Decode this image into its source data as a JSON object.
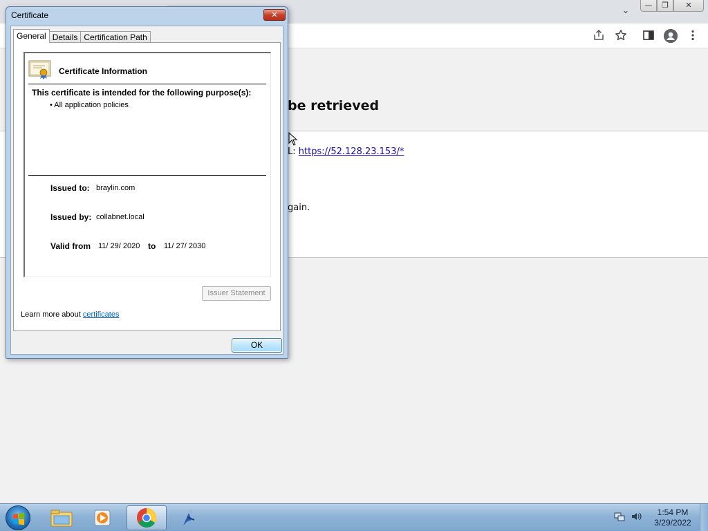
{
  "browser": {
    "heading_fragment": "be retrieved",
    "url_prefix": "L:",
    "url_link": "https://52.128.23.153/*",
    "again_fragment": "gain.",
    "window_buttons": {
      "minimize": "—",
      "restore": "❐",
      "close": "✕"
    },
    "toolbar_icons": [
      "share-icon",
      "star-icon",
      "side-panel-icon",
      "profile-icon",
      "menu-icon"
    ]
  },
  "dialog": {
    "title": "Certificate",
    "close_label": "✕",
    "tabs": [
      "General",
      "Details",
      "Certification Path"
    ],
    "info_header": "Certificate Information",
    "purpose_title": "This certificate is intended for the following purpose(s):",
    "purpose_items": [
      "• All application policies"
    ],
    "issued_to_label": "Issued to:",
    "issued_to_value": "braylin.com",
    "issued_by_label": "Issued by:",
    "issued_by_value": "collabnet.local",
    "valid_from_label": "Valid from",
    "valid_from_value": "11/ 29/ 2020",
    "valid_to_label": "to",
    "valid_to_value": "11/ 27/ 2030",
    "issuer_statement_label": "Issuer Statement",
    "learn_more_text": "Learn more about",
    "learn_more_link": "certificates",
    "ok_label": "OK"
  },
  "taskbar": {
    "apps": [
      "explorer-icon",
      "media-player-icon",
      "chrome-icon",
      "app-icon"
    ],
    "active_app": "chrome-icon",
    "clock_time": "1:54 PM",
    "clock_date": "3/29/2022"
  }
}
